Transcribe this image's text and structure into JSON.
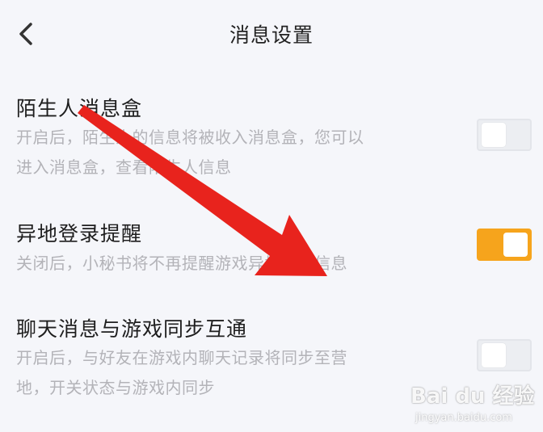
{
  "header": {
    "title": "消息设置"
  },
  "settings": [
    {
      "title": "陌生人消息盒",
      "desc_lines": [
        "开启后，陌生人的信息将被收入消息盒，您可以",
        "进入消息盒，查看陌生人信息"
      ],
      "enabled": false
    },
    {
      "title": "异地登录提醒",
      "desc_lines": [
        "关闭后，小秘书将不再提醒游戏异地登录信息"
      ],
      "enabled": true
    },
    {
      "title": "聊天消息与游戏同步互通",
      "desc_lines": [
        "开启后，与好友在游戏内聊天记录将同步至营",
        "地，开关状态与游戏内同步"
      ],
      "enabled": false
    }
  ],
  "colors": {
    "accent": "#f6a41c",
    "arrow": "#e8231d",
    "background": "#f5f6fa"
  },
  "watermark": {
    "brand": "Bai du 经验",
    "url": "jingyan.baidu.com"
  }
}
